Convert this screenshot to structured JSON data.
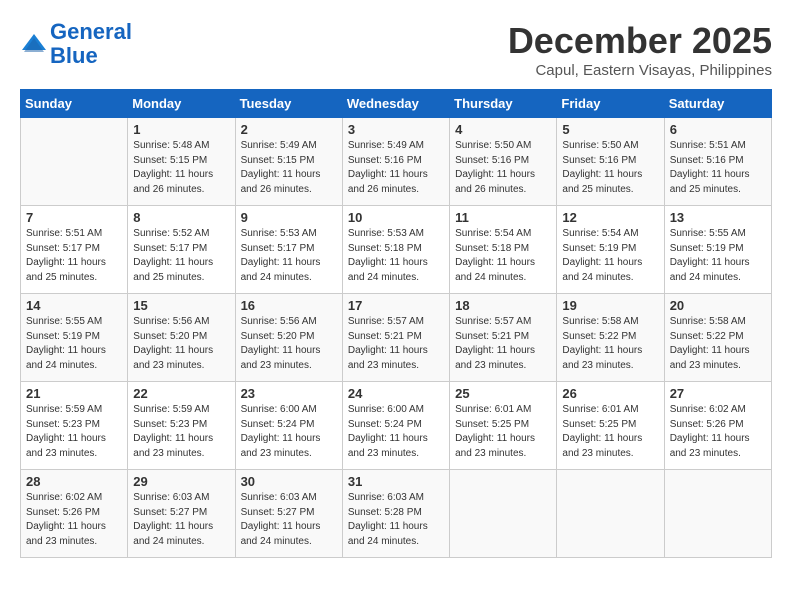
{
  "logo": {
    "line1": "General",
    "line2": "Blue"
  },
  "title": "December 2025",
  "location": "Capul, Eastern Visayas, Philippines",
  "days_header": [
    "Sunday",
    "Monday",
    "Tuesday",
    "Wednesday",
    "Thursday",
    "Friday",
    "Saturday"
  ],
  "weeks": [
    [
      {
        "day": "",
        "sunrise": "",
        "sunset": "",
        "daylight": ""
      },
      {
        "day": "1",
        "sunrise": "Sunrise: 5:48 AM",
        "sunset": "Sunset: 5:15 PM",
        "daylight": "Daylight: 11 hours and 26 minutes."
      },
      {
        "day": "2",
        "sunrise": "Sunrise: 5:49 AM",
        "sunset": "Sunset: 5:15 PM",
        "daylight": "Daylight: 11 hours and 26 minutes."
      },
      {
        "day": "3",
        "sunrise": "Sunrise: 5:49 AM",
        "sunset": "Sunset: 5:16 PM",
        "daylight": "Daylight: 11 hours and 26 minutes."
      },
      {
        "day": "4",
        "sunrise": "Sunrise: 5:50 AM",
        "sunset": "Sunset: 5:16 PM",
        "daylight": "Daylight: 11 hours and 26 minutes."
      },
      {
        "day": "5",
        "sunrise": "Sunrise: 5:50 AM",
        "sunset": "Sunset: 5:16 PM",
        "daylight": "Daylight: 11 hours and 25 minutes."
      },
      {
        "day": "6",
        "sunrise": "Sunrise: 5:51 AM",
        "sunset": "Sunset: 5:16 PM",
        "daylight": "Daylight: 11 hours and 25 minutes."
      }
    ],
    [
      {
        "day": "7",
        "sunrise": "Sunrise: 5:51 AM",
        "sunset": "Sunset: 5:17 PM",
        "daylight": "Daylight: 11 hours and 25 minutes."
      },
      {
        "day": "8",
        "sunrise": "Sunrise: 5:52 AM",
        "sunset": "Sunset: 5:17 PM",
        "daylight": "Daylight: 11 hours and 25 minutes."
      },
      {
        "day": "9",
        "sunrise": "Sunrise: 5:53 AM",
        "sunset": "Sunset: 5:17 PM",
        "daylight": "Daylight: 11 hours and 24 minutes."
      },
      {
        "day": "10",
        "sunrise": "Sunrise: 5:53 AM",
        "sunset": "Sunset: 5:18 PM",
        "daylight": "Daylight: 11 hours and 24 minutes."
      },
      {
        "day": "11",
        "sunrise": "Sunrise: 5:54 AM",
        "sunset": "Sunset: 5:18 PM",
        "daylight": "Daylight: 11 hours and 24 minutes."
      },
      {
        "day": "12",
        "sunrise": "Sunrise: 5:54 AM",
        "sunset": "Sunset: 5:19 PM",
        "daylight": "Daylight: 11 hours and 24 minutes."
      },
      {
        "day": "13",
        "sunrise": "Sunrise: 5:55 AM",
        "sunset": "Sunset: 5:19 PM",
        "daylight": "Daylight: 11 hours and 24 minutes."
      }
    ],
    [
      {
        "day": "14",
        "sunrise": "Sunrise: 5:55 AM",
        "sunset": "Sunset: 5:19 PM",
        "daylight": "Daylight: 11 hours and 24 minutes."
      },
      {
        "day": "15",
        "sunrise": "Sunrise: 5:56 AM",
        "sunset": "Sunset: 5:20 PM",
        "daylight": "Daylight: 11 hours and 23 minutes."
      },
      {
        "day": "16",
        "sunrise": "Sunrise: 5:56 AM",
        "sunset": "Sunset: 5:20 PM",
        "daylight": "Daylight: 11 hours and 23 minutes."
      },
      {
        "day": "17",
        "sunrise": "Sunrise: 5:57 AM",
        "sunset": "Sunset: 5:21 PM",
        "daylight": "Daylight: 11 hours and 23 minutes."
      },
      {
        "day": "18",
        "sunrise": "Sunrise: 5:57 AM",
        "sunset": "Sunset: 5:21 PM",
        "daylight": "Daylight: 11 hours and 23 minutes."
      },
      {
        "day": "19",
        "sunrise": "Sunrise: 5:58 AM",
        "sunset": "Sunset: 5:22 PM",
        "daylight": "Daylight: 11 hours and 23 minutes."
      },
      {
        "day": "20",
        "sunrise": "Sunrise: 5:58 AM",
        "sunset": "Sunset: 5:22 PM",
        "daylight": "Daylight: 11 hours and 23 minutes."
      }
    ],
    [
      {
        "day": "21",
        "sunrise": "Sunrise: 5:59 AM",
        "sunset": "Sunset: 5:23 PM",
        "daylight": "Daylight: 11 hours and 23 minutes."
      },
      {
        "day": "22",
        "sunrise": "Sunrise: 5:59 AM",
        "sunset": "Sunset: 5:23 PM",
        "daylight": "Daylight: 11 hours and 23 minutes."
      },
      {
        "day": "23",
        "sunrise": "Sunrise: 6:00 AM",
        "sunset": "Sunset: 5:24 PM",
        "daylight": "Daylight: 11 hours and 23 minutes."
      },
      {
        "day": "24",
        "sunrise": "Sunrise: 6:00 AM",
        "sunset": "Sunset: 5:24 PM",
        "daylight": "Daylight: 11 hours and 23 minutes."
      },
      {
        "day": "25",
        "sunrise": "Sunrise: 6:01 AM",
        "sunset": "Sunset: 5:25 PM",
        "daylight": "Daylight: 11 hours and 23 minutes."
      },
      {
        "day": "26",
        "sunrise": "Sunrise: 6:01 AM",
        "sunset": "Sunset: 5:25 PM",
        "daylight": "Daylight: 11 hours and 23 minutes."
      },
      {
        "day": "27",
        "sunrise": "Sunrise: 6:02 AM",
        "sunset": "Sunset: 5:26 PM",
        "daylight": "Daylight: 11 hours and 23 minutes."
      }
    ],
    [
      {
        "day": "28",
        "sunrise": "Sunrise: 6:02 AM",
        "sunset": "Sunset: 5:26 PM",
        "daylight": "Daylight: 11 hours and 23 minutes."
      },
      {
        "day": "29",
        "sunrise": "Sunrise: 6:03 AM",
        "sunset": "Sunset: 5:27 PM",
        "daylight": "Daylight: 11 hours and 24 minutes."
      },
      {
        "day": "30",
        "sunrise": "Sunrise: 6:03 AM",
        "sunset": "Sunset: 5:27 PM",
        "daylight": "Daylight: 11 hours and 24 minutes."
      },
      {
        "day": "31",
        "sunrise": "Sunrise: 6:03 AM",
        "sunset": "Sunset: 5:28 PM",
        "daylight": "Daylight: 11 hours and 24 minutes."
      },
      {
        "day": "",
        "sunrise": "",
        "sunset": "",
        "daylight": ""
      },
      {
        "day": "",
        "sunrise": "",
        "sunset": "",
        "daylight": ""
      },
      {
        "day": "",
        "sunrise": "",
        "sunset": "",
        "daylight": ""
      }
    ]
  ]
}
